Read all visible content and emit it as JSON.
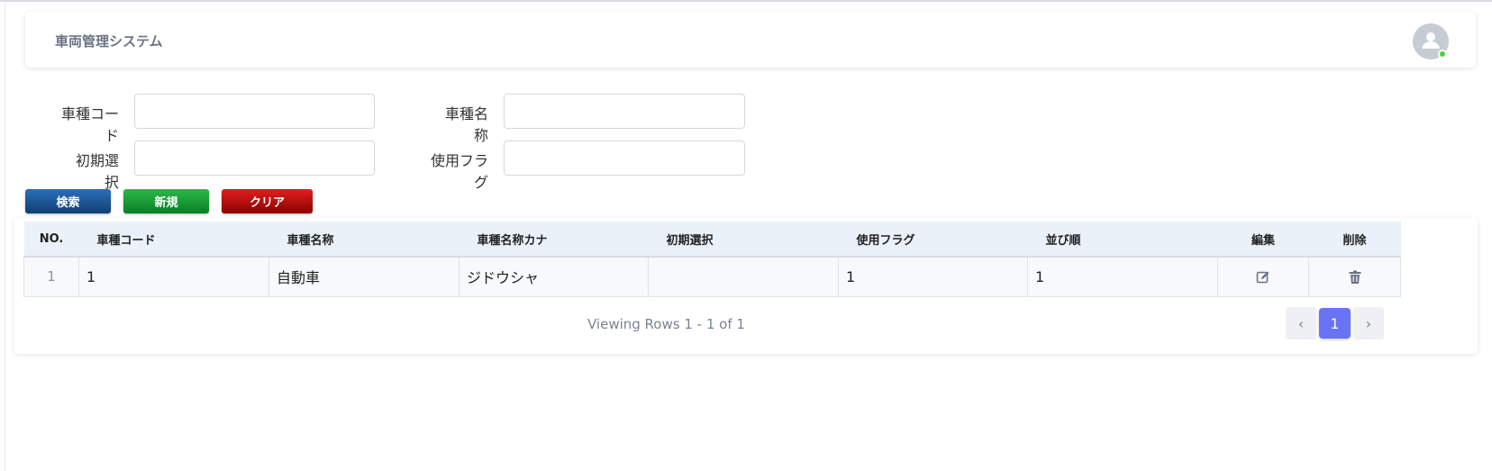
{
  "app": {
    "title": "車両管理システム"
  },
  "form": {
    "vehicle_code_label": "車種コード",
    "vehicle_name_label": "車種名称",
    "initial_select_label": "初期選択",
    "use_flag_label": "使用フラグ",
    "vehicle_code_value": "",
    "vehicle_name_value": "",
    "initial_select_value": "",
    "use_flag_value": ""
  },
  "buttons": {
    "search": "検索",
    "new": "新規",
    "clear": "クリア"
  },
  "table": {
    "headers": [
      "NO.",
      "車種コード",
      "車種名称",
      "車種名称カナ",
      "初期選択",
      "使用フラグ",
      "並び順",
      "編集",
      "削除"
    ],
    "rows": [
      {
        "no": "1",
        "code": "1",
        "name": "自動車",
        "kana": "ジドウシャ",
        "initial": "",
        "flag": "1",
        "order": "1"
      }
    ]
  },
  "pagination": {
    "summary": "Viewing Rows 1 - 1 of 1",
    "current_page": "1",
    "prev": "‹",
    "next": "›"
  },
  "colors": {
    "accent": "#6a73f5",
    "search_btn": "#1b5597",
    "new_btn": "#159a33",
    "clear_btn": "#b50d0d",
    "online": "#4cd137"
  }
}
